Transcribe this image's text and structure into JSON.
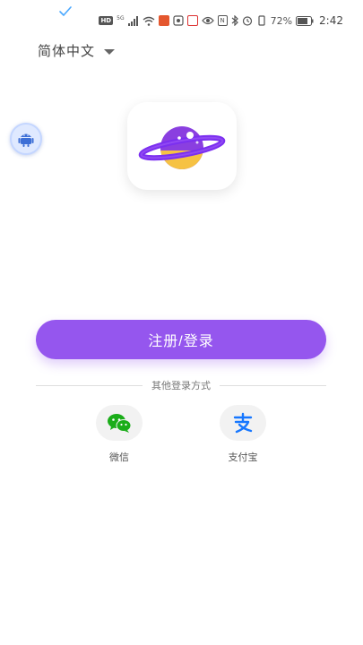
{
  "status_bar": {
    "network_hd": "HD",
    "network_gen": "5G",
    "battery_percent": "72%",
    "time": "2:42"
  },
  "language_selector": {
    "label": "简体中文"
  },
  "primary_button": {
    "label": "注册/登录"
  },
  "divider": {
    "label": "其他登录方式"
  },
  "third_party": {
    "wechat_label": "微信",
    "alipay_label": "支付宝"
  },
  "colors": {
    "accent": "#9556ee",
    "wechat": "#1aad19",
    "alipay": "#1677ff",
    "planet_purple": "#8a3fe0",
    "ring_yellow": "#f6c243"
  }
}
